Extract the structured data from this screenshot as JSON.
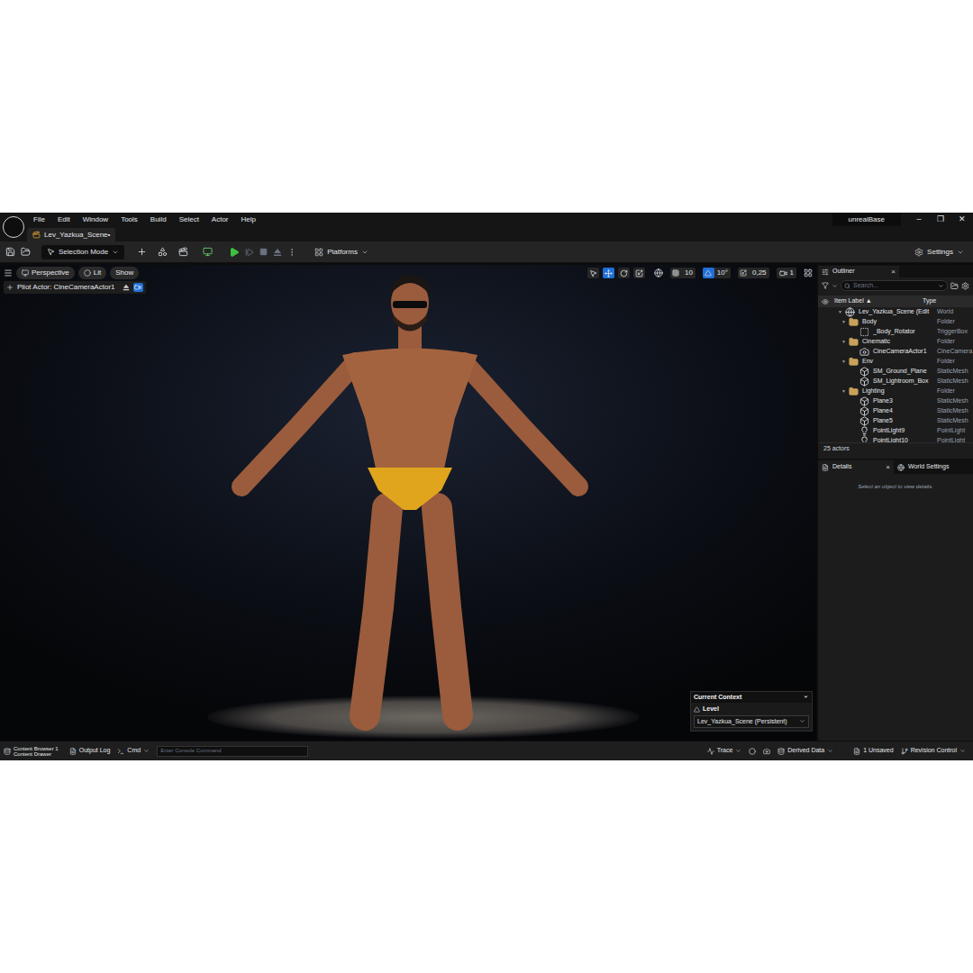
{
  "menu": [
    "File",
    "Edit",
    "Window",
    "Tools",
    "Build",
    "Select",
    "Actor",
    "Help"
  ],
  "project": "unrealBase",
  "window_controls": [
    "–",
    "❐",
    "✕"
  ],
  "level_tab": {
    "label": "Lev_Yazkua_Scene•",
    "selected": true
  },
  "toolbar": {
    "mode": "Selection Mode",
    "platforms": "Platforms",
    "settings": "Settings"
  },
  "viewport": {
    "view": "Perspective",
    "lighting": "Lit",
    "show": "Show",
    "pilot": "Pilot Actor: CineCameraActor1",
    "tools": [
      {
        "name": "select",
        "selected": false
      },
      {
        "name": "move",
        "selected": true
      },
      {
        "name": "rotate",
        "selected": false
      },
      {
        "name": "scale",
        "selected": false
      }
    ],
    "snaps": [
      {
        "kind": "grid",
        "value": "10",
        "on": false
      },
      {
        "kind": "angle",
        "value": "10°",
        "on": true
      },
      {
        "kind": "scale",
        "value": "0,25",
        "on": false
      }
    ],
    "camera_speed": "1"
  },
  "context": {
    "title": "Current Context",
    "label": "Level",
    "value": "Lev_Yazkua_Scene (Persistent)"
  },
  "outliner": {
    "title": "Outliner",
    "close": "×",
    "search_placeholder": "Search...",
    "columns": {
      "label": "Item Label",
      "sort": "▲",
      "type": "Type"
    },
    "rows": [
      {
        "kind": "world",
        "label": "Lev_Yazkua_Scene (Edit",
        "type": "World",
        "expanded": true
      },
      {
        "kind": "folder",
        "label": "Body",
        "type": "Folder",
        "expanded": true
      },
      {
        "kind": "trigger",
        "label": "_Body_Rotator",
        "type": "TriggerBox",
        "expanded": false
      },
      {
        "kind": "folder",
        "label": "Cinematic",
        "type": "Folder",
        "expanded": true
      },
      {
        "kind": "camera",
        "label": "CineCameraActor1",
        "type": "CineCamera",
        "expanded": false
      },
      {
        "kind": "folder",
        "label": "Env",
        "type": "Folder",
        "expanded": true
      },
      {
        "kind": "mesh",
        "label": "SM_Ground_Plane",
        "type": "StaticMesh",
        "expanded": false
      },
      {
        "kind": "mesh",
        "label": "SM_Lightroom_Box",
        "type": "StaticMesh",
        "expanded": false
      },
      {
        "kind": "folder",
        "label": "Lighting",
        "type": "Folder",
        "expanded": true
      },
      {
        "kind": "mesh",
        "label": "Plane3",
        "type": "StaticMesh",
        "expanded": false
      },
      {
        "kind": "mesh",
        "label": "Plane4",
        "type": "StaticMesh",
        "expanded": false
      },
      {
        "kind": "mesh",
        "label": "Plane5",
        "type": "StaticMesh",
        "expanded": false
      },
      {
        "kind": "light",
        "label": "PointLight9",
        "type": "PointLight",
        "expanded": false
      },
      {
        "kind": "light",
        "label": "PointLight10",
        "type": "PointLight",
        "expanded": false
      }
    ],
    "count": "25 actors"
  },
  "details": {
    "tabs": [
      {
        "label": "Details",
        "selected": true,
        "close": "×"
      },
      {
        "label": "World Settings",
        "selected": false,
        "close": ""
      }
    ],
    "empty": "Select an object to view details."
  },
  "status_bar": {
    "content_browser": "Content Browser 1",
    "content_drawer": "Content Drawer",
    "output_log": "Output Log",
    "cmd": "Cmd",
    "console_placeholder": "Enter Console Command",
    "trace": "Trace",
    "derived_data": "Derived Data",
    "unsaved": "1 Unsaved",
    "revision_control": "Revision Control"
  }
}
